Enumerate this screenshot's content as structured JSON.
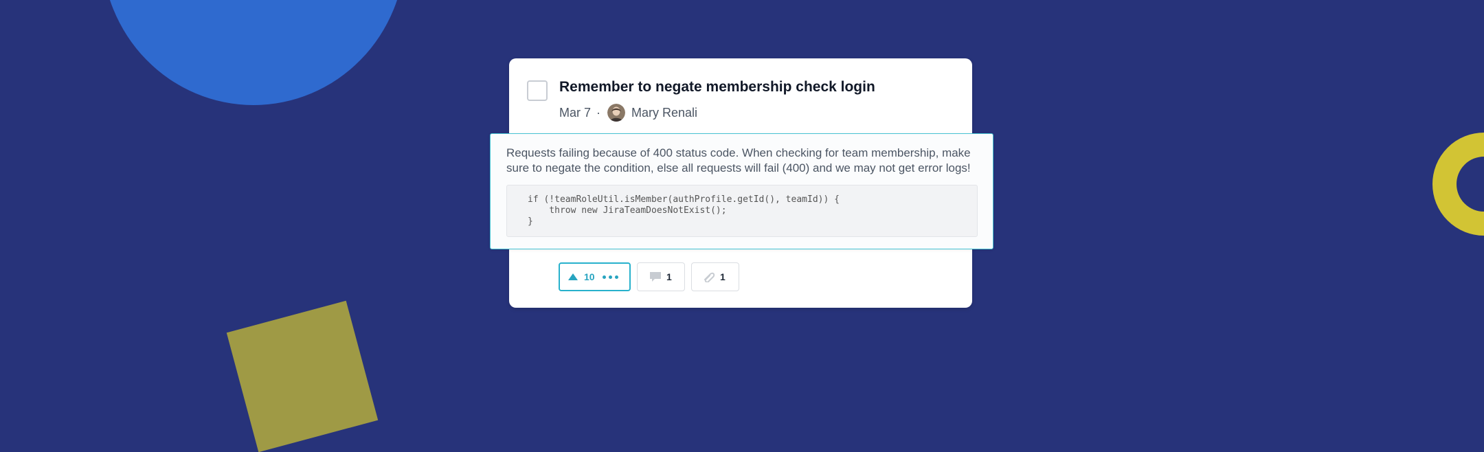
{
  "task": {
    "title": "Remember to negate membership check login",
    "date": "Mar 7",
    "separator": "·",
    "author": "Mary Renali",
    "description": "Requests failing because of 400 status code. When checking for team membership, make sure to negate the condition, else all requests will fail (400) and we may not get error logs!",
    "code": [
      "if (!teamRoleUtil.isMember(authProfile.getId(), teamId)) {",
      "    throw new JiraTeamDoesNotExist();",
      "}"
    ]
  },
  "actions": {
    "upvotes": "10",
    "comments": "1",
    "attachments": "1"
  },
  "icons": {
    "upvote": "triangle-up-icon",
    "more": "more-dots-icon",
    "comment": "speech-bubble-icon",
    "attachment": "paperclip-icon"
  },
  "colors": {
    "background": "#27337a",
    "accent": "#27b1cc",
    "circle": "#2f6acf",
    "ring": "#d2c434",
    "square": "#9f9a45"
  }
}
